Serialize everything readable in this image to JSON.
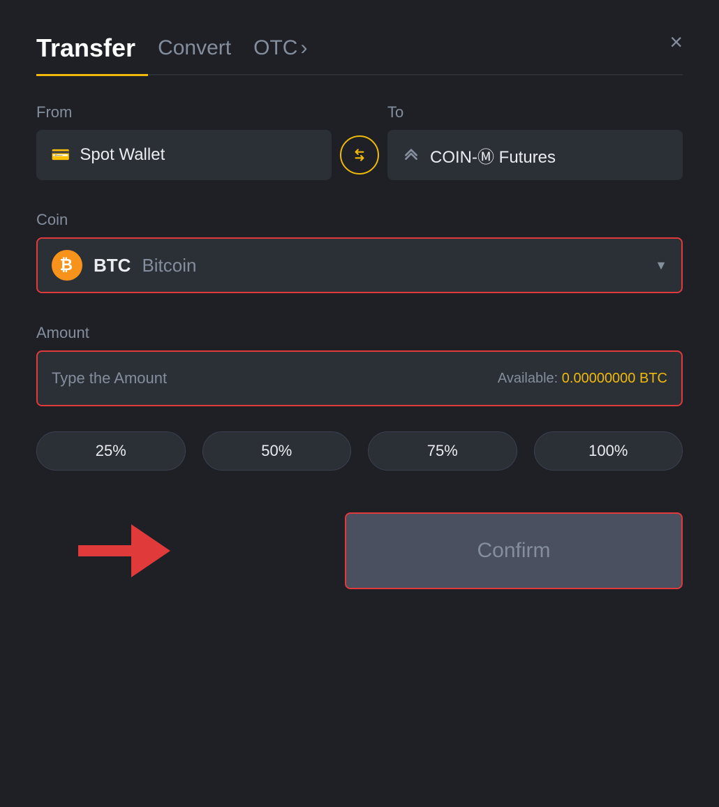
{
  "header": {
    "tab_transfer": "Transfer",
    "tab_convert": "Convert",
    "tab_otc": "OTC",
    "tab_otc_arrow": "›",
    "close_label": "×"
  },
  "from_section": {
    "label": "From",
    "wallet_name": "Spot Wallet"
  },
  "to_section": {
    "label": "To",
    "wallet_name": "COIN-M Futures"
  },
  "coin_section": {
    "label": "Coin",
    "coin_symbol": "BTC",
    "coin_name": "Bitcoin",
    "coin_icon": "₿"
  },
  "amount_section": {
    "label": "Amount",
    "placeholder": "Type the Amount",
    "available_label": "Available:",
    "available_value": "0.00000000 BTC"
  },
  "pct_buttons": [
    {
      "label": "25%"
    },
    {
      "label": "50%"
    },
    {
      "label": "75%"
    },
    {
      "label": "100%"
    }
  ],
  "confirm_button": {
    "label": "Confirm"
  }
}
